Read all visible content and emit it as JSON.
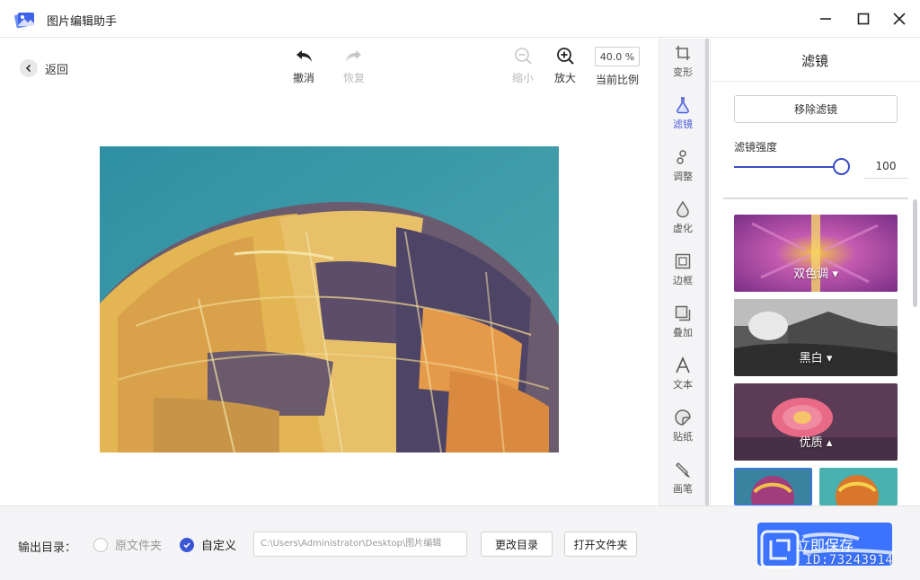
{
  "titlebar": {
    "title": "图片编辑助手"
  },
  "toolbar": {
    "back": "返回",
    "undo": "撤消",
    "redo": "恢复",
    "zoom_out": "缩小",
    "zoom_in": "放大",
    "zoom_value": "40.0 %",
    "zoom_label": "当前比例"
  },
  "tool_strip": {
    "items": [
      {
        "label": "变形",
        "icon": "crop-icon"
      },
      {
        "label": "滤镜",
        "icon": "flask-icon"
      },
      {
        "label": "调整",
        "icon": "adjust-icon"
      },
      {
        "label": "虚化",
        "icon": "drop-icon"
      },
      {
        "label": "边框",
        "icon": "frame-icon"
      },
      {
        "label": "叠加",
        "icon": "overlay-icon"
      },
      {
        "label": "文本",
        "icon": "text-icon"
      },
      {
        "label": "贴纸",
        "icon": "sticker-icon"
      },
      {
        "label": "画笔",
        "icon": "brush-icon"
      }
    ],
    "active": "滤镜"
  },
  "panel": {
    "title": "滤镜",
    "remove_button": "移除滤镜",
    "strength_label": "滤镜强度",
    "strength_value": "100",
    "strength_fraction": 1.0,
    "filters": [
      {
        "label": "双色调"
      },
      {
        "label": "黑白"
      },
      {
        "label": "优质"
      }
    ]
  },
  "bottom": {
    "output_label": "输出目录：",
    "option_original": "原文件夹",
    "option_custom": "自定义",
    "path": "C:\\Users\\Administrator\\Desktop\\图片编辑",
    "change_dir": "更改目录",
    "open_folder": "打开文件夹",
    "apply": "立即保存"
  },
  "watermark": {
    "id_text": "ID:73243914"
  },
  "colors": {
    "accent": "#3a4cc7",
    "apply": "#3b73ff",
    "checked": "#3a56d4"
  }
}
